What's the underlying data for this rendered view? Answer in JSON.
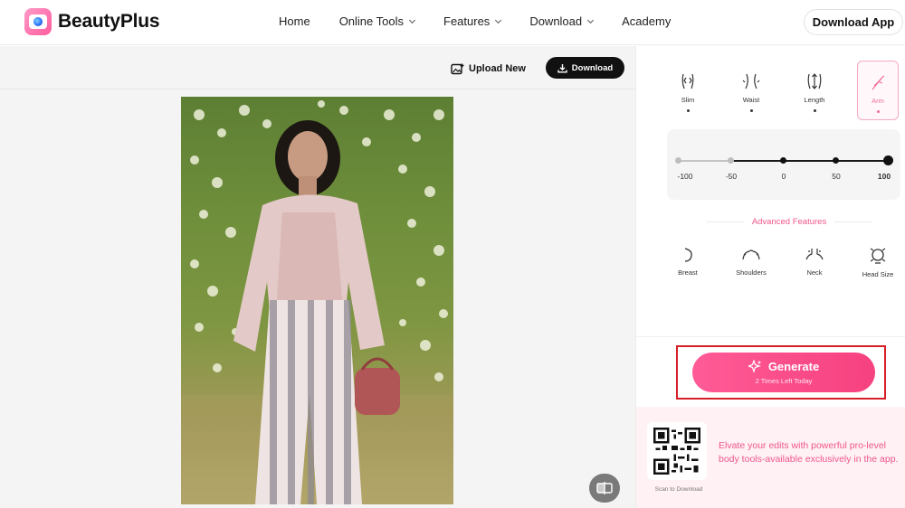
{
  "brand": {
    "name": "BeautyPlus",
    "logo_icon": "camera-logo-icon",
    "accent": "#f0568c"
  },
  "nav": {
    "items": [
      {
        "label": "Home",
        "has_dropdown": false
      },
      {
        "label": "Online Tools",
        "has_dropdown": true
      },
      {
        "label": "Features",
        "has_dropdown": true
      },
      {
        "label": "Download",
        "has_dropdown": true
      },
      {
        "label": "Academy",
        "has_dropdown": false
      }
    ],
    "download_app": "Download App"
  },
  "toolbar": {
    "upload_new": "Upload New",
    "download": "Download"
  },
  "body_tools": [
    {
      "label": "Slim",
      "icon": "slim-icon",
      "active": false
    },
    {
      "label": "Waist",
      "icon": "waist-icon",
      "active": false
    },
    {
      "label": "Length",
      "icon": "length-icon",
      "active": false
    },
    {
      "label": "Arm",
      "icon": "arm-icon",
      "active": true
    }
  ],
  "slider": {
    "ticks": [
      "-100",
      "-50",
      "0",
      "50",
      "100"
    ],
    "value": 100,
    "min": -100,
    "max": 100
  },
  "advanced": {
    "title": "Advanced Features",
    "tools": [
      {
        "label": "Breast",
        "icon": "breast-icon"
      },
      {
        "label": "Shoulders",
        "icon": "shoulders-icon"
      },
      {
        "label": "Neck",
        "icon": "neck-icon"
      },
      {
        "label": "Head Size",
        "icon": "head-size-icon"
      }
    ]
  },
  "generate": {
    "label": "Generate",
    "sub": "2 Times Left Today",
    "highlight_color": "#d61f26"
  },
  "promo": {
    "qr_caption": "Scan to Download",
    "text": "Elvate your edits with powerful pro-level body tools-available exclusively in the app."
  }
}
